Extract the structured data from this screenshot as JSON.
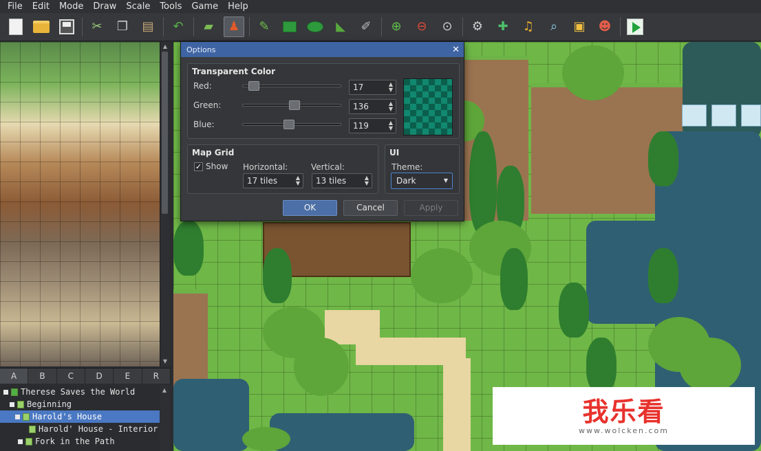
{
  "menu": [
    "File",
    "Edit",
    "Mode",
    "Draw",
    "Scale",
    "Tools",
    "Game",
    "Help"
  ],
  "toolbar": {
    "groups": [
      [
        "new-document-icon",
        "open-folder-icon",
        "save-disk-icon"
      ],
      [
        "cut-icon",
        "copy-icon",
        "paste-icon"
      ],
      [
        "undo-icon"
      ],
      [
        "map-layer-icon",
        "event-layer-icon"
      ],
      [
        "pencil-icon",
        "rectangle-icon",
        "ellipse-icon",
        "flood-fill-icon",
        "shadow-pen-icon"
      ],
      [
        "zoom-in-icon",
        "zoom-out-icon",
        "zoom-actual-icon"
      ],
      [
        "database-icon",
        "plugin-manager-icon",
        "sound-test-icon",
        "event-searcher-icon",
        "resource-manager-icon",
        "character-generator-icon"
      ],
      [
        "playtest-icon"
      ]
    ]
  },
  "tileset_tabs": [
    "A",
    "B",
    "C",
    "D",
    "E",
    "R"
  ],
  "project_tree": [
    {
      "label": "Therese Saves the World",
      "level": 0,
      "selected": false
    },
    {
      "label": "Beginning",
      "level": 1,
      "selected": false
    },
    {
      "label": "Harold's House",
      "level": 2,
      "selected": true
    },
    {
      "label": "Harold' House - Interior",
      "level": 3,
      "selected": false
    },
    {
      "label": "Fork in the Path",
      "level": 2,
      "selected": false
    }
  ],
  "options_dialog": {
    "title": "Options",
    "close_glyph": "✕",
    "transparent_color": {
      "heading": "Transparent Color",
      "red_label": "Red:",
      "red_value": "17",
      "red_fraction": 0.067,
      "green_label": "Green:",
      "green_value": "136",
      "green_fraction": 0.533,
      "blue_label": "Blue:",
      "blue_value": "119",
      "blue_fraction": 0.467,
      "swatch_color": "#118877"
    },
    "map_grid": {
      "heading": "Map Grid",
      "show_label": "Show",
      "show_checked": true,
      "horizontal_label": "Horizontal:",
      "horizontal_value": "17 tiles",
      "vertical_label": "Vertical:",
      "vertical_value": "13 tiles"
    },
    "ui": {
      "heading": "UI",
      "theme_label": "Theme:",
      "theme_value": "Dark"
    },
    "buttons": {
      "ok": "OK",
      "cancel": "Cancel",
      "apply": "Apply"
    }
  },
  "watermark": {
    "big": "我乐看",
    "small": "www.wolcken.com"
  }
}
